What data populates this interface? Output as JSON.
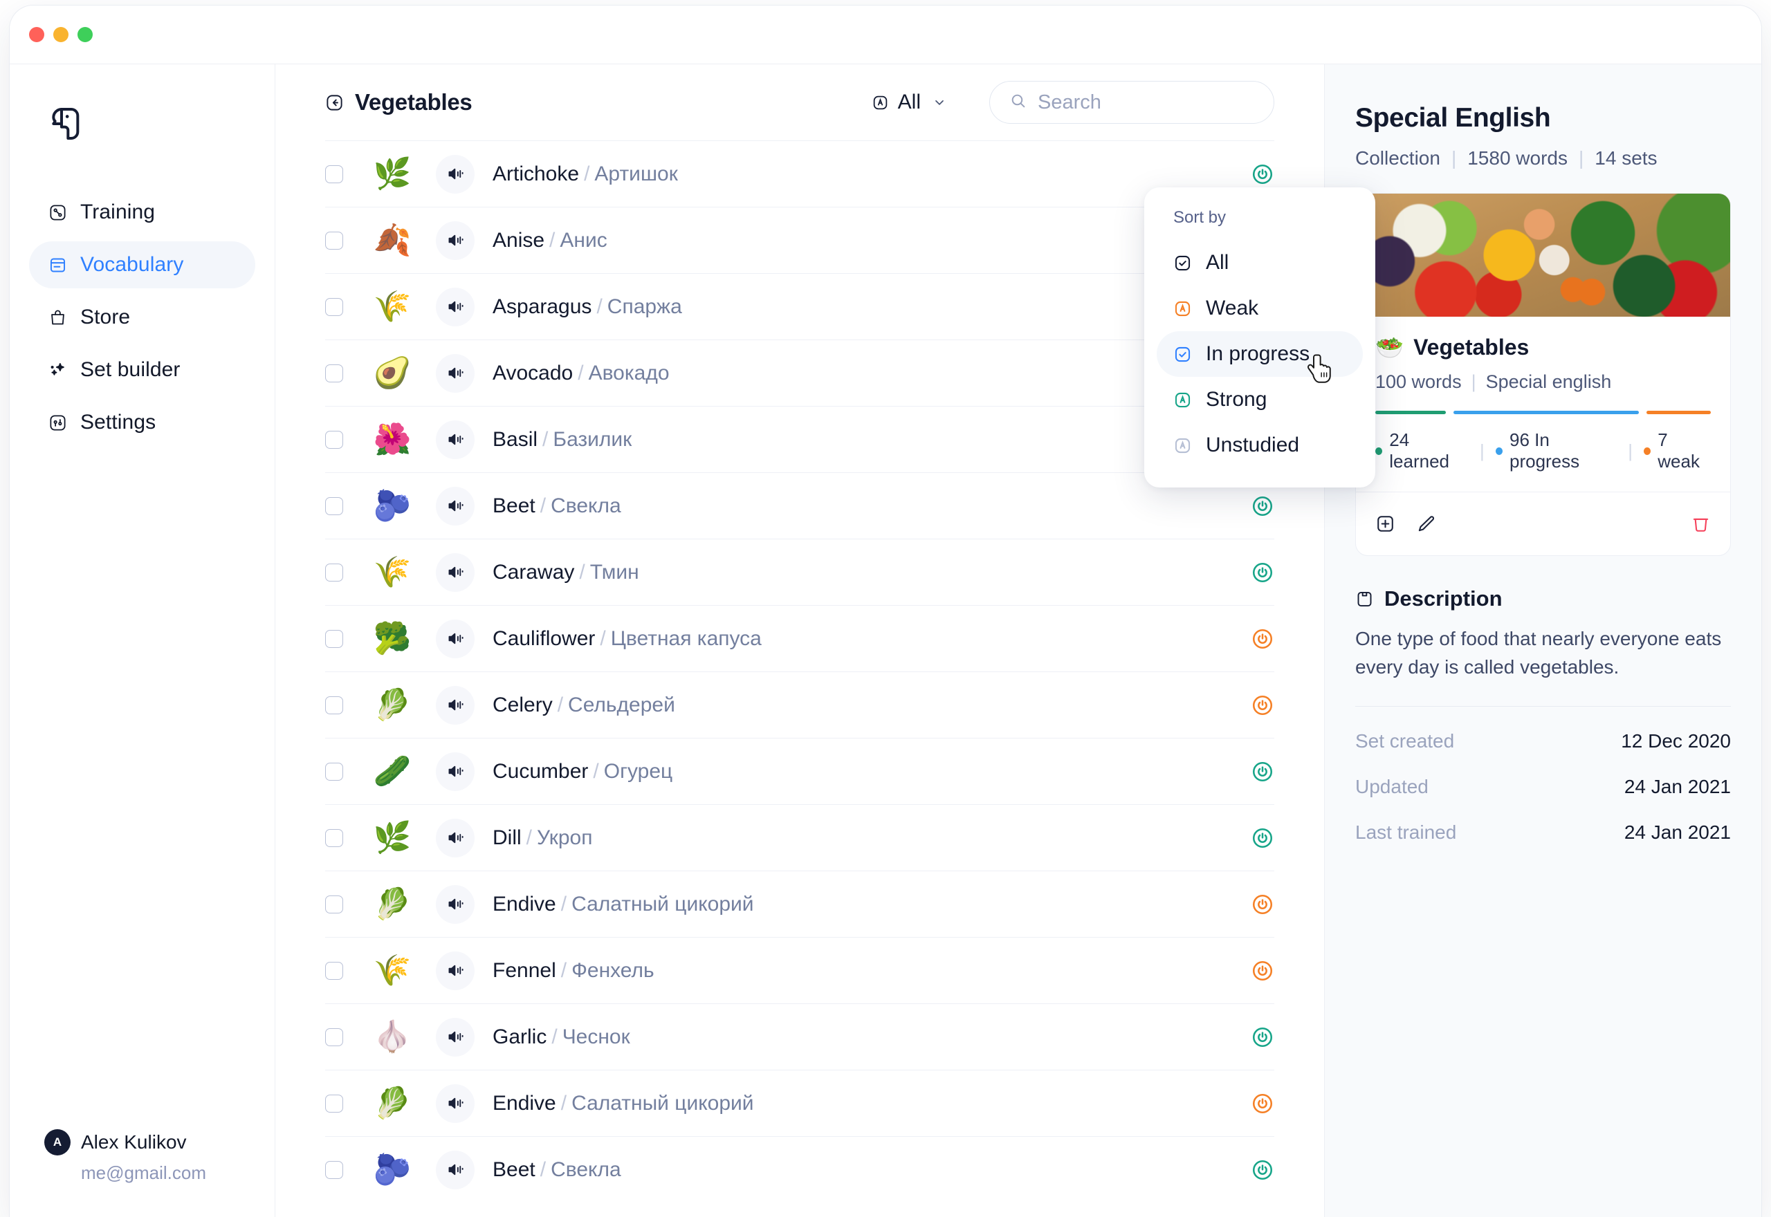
{
  "window": {
    "dots": [
      "close",
      "minimize",
      "maximize"
    ]
  },
  "sidebar": {
    "logo_icon": "parrot-logo-icon",
    "items": [
      {
        "label": "Training",
        "icon": "training-icon",
        "active": false
      },
      {
        "label": "Vocabulary",
        "icon": "vocabulary-icon",
        "active": true
      },
      {
        "label": "Store",
        "icon": "store-icon",
        "active": false
      },
      {
        "label": "Set builder",
        "icon": "sparkle-icon",
        "active": false
      },
      {
        "label": "Settings",
        "icon": "settings-icon",
        "active": false
      }
    ],
    "user": {
      "initial": "A",
      "name": "Alex Kulikov",
      "email": "me@gmail.com"
    }
  },
  "main": {
    "back_icon": "back-arrow-icon",
    "title": "Vegetables",
    "filter": {
      "icon": "status-all-icon",
      "label": "All",
      "chevron": "chevron-down-icon"
    },
    "search": {
      "icon": "search-icon",
      "placeholder": "Search",
      "value": ""
    },
    "dropdown": {
      "title": "Sort by",
      "items": [
        {
          "label": "All",
          "icon": "check-square-icon",
          "color": "#151c33",
          "active": false
        },
        {
          "label": "Weak",
          "icon": "letter-a-box-icon",
          "color": "#f58026",
          "active": false
        },
        {
          "label": "In progress",
          "icon": "check-square-icon",
          "color": "#2f80ff",
          "active": true
        },
        {
          "label": "Strong",
          "icon": "letter-a-box-icon",
          "color": "#17a589",
          "active": false
        },
        {
          "label": "Unstudied",
          "icon": "letter-a-box-icon",
          "color": "#b6bfd4",
          "active": false
        }
      ]
    },
    "status_colors": {
      "strong": "#17a589",
      "progress": "#2f93f3",
      "weak": "#f58026"
    },
    "rows": [
      {
        "emoji": "🌿",
        "word": "Artichoke",
        "translation": "Артишок",
        "status": "strong"
      },
      {
        "emoji": "🍂",
        "word": "Anise",
        "translation": "Анис",
        "status": "strong"
      },
      {
        "emoji": "🌾",
        "word": "Asparagus",
        "translation": "Спаржа",
        "status": "progress"
      },
      {
        "emoji": "🥑",
        "word": "Avocado",
        "translation": "Авокадо",
        "status": "progress"
      },
      {
        "emoji": "🌺",
        "word": "Basil",
        "translation": "Базилик",
        "status": "progress"
      },
      {
        "emoji": "🫐",
        "word": "Beet",
        "translation": "Свекла",
        "status": "strong"
      },
      {
        "emoji": "🌾",
        "word": "Caraway",
        "translation": "Тмин",
        "status": "strong"
      },
      {
        "emoji": "🥦",
        "word": "Cauliflower",
        "translation": "Цветная капуса",
        "status": "weak"
      },
      {
        "emoji": "🥬",
        "word": "Celery",
        "translation": "Сельдерей",
        "status": "weak"
      },
      {
        "emoji": "🥒",
        "word": "Cucumber",
        "translation": "Огурец",
        "status": "strong"
      },
      {
        "emoji": "🌿",
        "word": "Dill",
        "translation": "Укроп",
        "status": "strong"
      },
      {
        "emoji": "🥬",
        "word": "Endive",
        "translation": "Салатный цикорий",
        "status": "weak"
      },
      {
        "emoji": "🌾",
        "word": "Fennel",
        "translation": "Фенхель",
        "status": "weak"
      },
      {
        "emoji": "🧄",
        "word": "Garlic",
        "translation": "Чеснок",
        "status": "strong"
      },
      {
        "emoji": "🥬",
        "word": "Endive",
        "translation": "Салатный цикорий",
        "status": "weak"
      },
      {
        "emoji": "🫐",
        "word": "Beet",
        "translation": "Свекла",
        "status": "strong"
      }
    ]
  },
  "right_panel": {
    "title": "Special English",
    "meta": {
      "type": "Collection",
      "words": "1580 words",
      "sets": "14 sets"
    },
    "set_card": {
      "emoji": "🥗",
      "title": "Vegetables",
      "words": "100 words",
      "collection": "Special english",
      "progress": {
        "learned": {
          "count": 24,
          "label": "24 learned",
          "color": "#1f9d72",
          "pct": 22
        },
        "progress": {
          "count": 96,
          "label": "96 In progress",
          "color": "#3aa0ec",
          "pct": 58
        },
        "weak": {
          "count": 7,
          "label": "7 weak",
          "color": "#f58026",
          "pct": 20
        }
      },
      "actions": [
        {
          "name": "add-icon",
          "icon": "plus-square-icon"
        },
        {
          "name": "edit-icon",
          "icon": "pencil-icon"
        },
        {
          "name": "delete-icon",
          "icon": "trash-icon",
          "color": "#f5405a"
        }
      ]
    },
    "description": {
      "icon": "description-icon",
      "title": "Description",
      "text": "One type of food that nearly everyone eats every day is called vegetables."
    },
    "meta_rows": [
      {
        "key": "Set created",
        "value": "12 Dec 2020"
      },
      {
        "key": "Updated",
        "value": "24 Jan 2021"
      },
      {
        "key": "Last trained",
        "value": "24 Jan 2021"
      }
    ]
  }
}
